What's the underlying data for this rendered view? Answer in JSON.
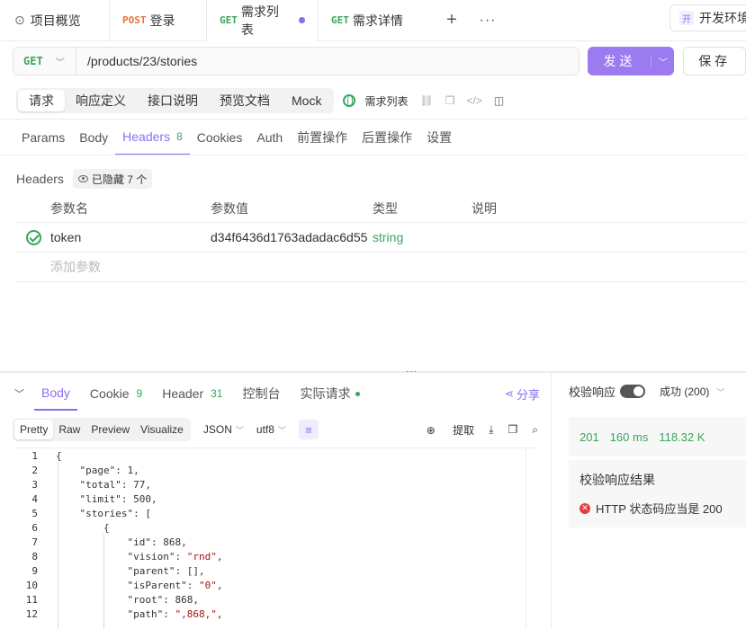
{
  "tabs": {
    "overview": "项目概览",
    "login": {
      "method": "POST",
      "label": "登录"
    },
    "list": {
      "method": "GET",
      "label": "需求列表"
    },
    "detail": {
      "method": "GET",
      "label": "需求详情"
    },
    "env": "开发环境"
  },
  "request": {
    "method": "GET",
    "path": "/products/23/stories",
    "send_label": "发送",
    "save_label": "保存"
  },
  "segments": [
    "请求",
    "响应定义",
    "接口说明",
    "预览文档",
    "Mock"
  ],
  "doc_link": "需求列表",
  "param_tabs": [
    {
      "label": "Params"
    },
    {
      "label": "Body"
    },
    {
      "label": "Headers",
      "count": "8"
    },
    {
      "label": "Cookies"
    },
    {
      "label": "Auth"
    },
    {
      "label": "前置操作"
    },
    {
      "label": "后置操作"
    },
    {
      "label": "设置"
    }
  ],
  "headers_section": {
    "title": "Headers",
    "hidden": "已隐藏 7 个",
    "columns": [
      "参数名",
      "参数值",
      "类型",
      "说明"
    ],
    "rows": [
      {
        "name": "token",
        "value": "d34f6436d1763adadac6d55",
        "type": "string",
        "desc": ""
      }
    ],
    "add_placeholder": "添加参数"
  },
  "response": {
    "tabs": [
      {
        "label": "Body"
      },
      {
        "label": "Cookie",
        "count": "9"
      },
      {
        "label": "Header",
        "count": "31"
      },
      {
        "label": "控制台"
      },
      {
        "label": "实际请求"
      }
    ],
    "share": "分享",
    "formats": [
      "Pretty",
      "Raw",
      "Preview",
      "Visualize"
    ],
    "lang": "JSON",
    "encoding": "utf8",
    "extract": "提取",
    "code_lines": [
      "{",
      "    \"page\": 1,",
      "    \"total\": 77,",
      "    \"limit\": 500,",
      "    \"stories\": [",
      "        {",
      "            \"id\": 868,",
      "            \"vision\": \"rnd\",",
      "            \"parent\": [],",
      "            \"isParent\": \"0\",",
      "            \"root\": 868,",
      "            \"path\": \",868,\","
    ]
  },
  "validation": {
    "label": "校验响应",
    "status": "成功 (200)",
    "code": "201",
    "time": "160 ms",
    "size": "118.32 K",
    "result_title": "校验响应结果",
    "result_item": "HTTP 状态码应当是 200"
  }
}
